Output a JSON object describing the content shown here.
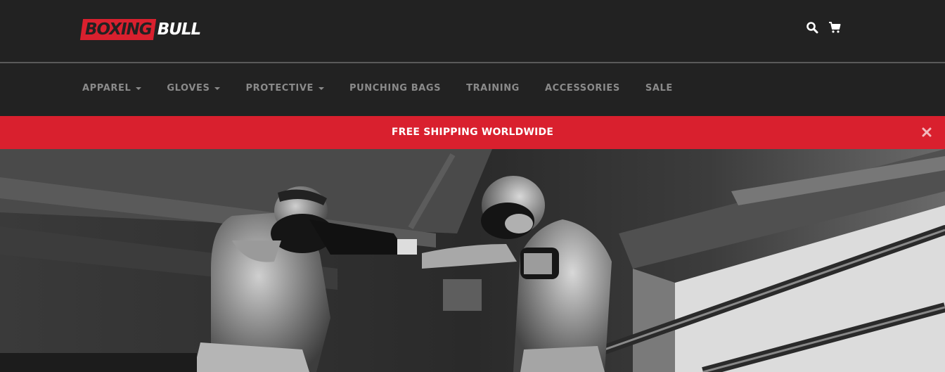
{
  "brand": {
    "logo_part1": "BOXING",
    "logo_part2": "BULL",
    "accent_color": "#d9202e"
  },
  "header": {
    "icons": [
      "search-icon",
      "cart-icon"
    ]
  },
  "nav": {
    "items": [
      {
        "label": "APPAREL",
        "dropdown": true
      },
      {
        "label": "GLOVES",
        "dropdown": true
      },
      {
        "label": "PROTECTIVE",
        "dropdown": true
      },
      {
        "label": "PUNCHING BAGS",
        "dropdown": false
      },
      {
        "label": "TRAINING",
        "dropdown": false
      },
      {
        "label": "ACCESSORIES",
        "dropdown": false
      },
      {
        "label": "SALE",
        "dropdown": false
      }
    ]
  },
  "banner": {
    "bold": "FREE",
    "text": " SHIPPING WORLDWIDE",
    "close_icon": "close-icon"
  }
}
